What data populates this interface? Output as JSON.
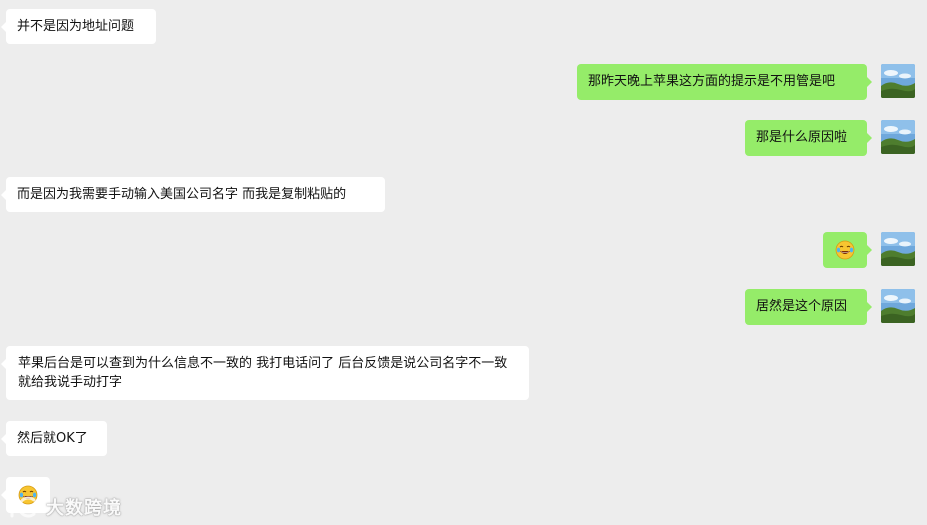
{
  "messages": [
    {
      "side": "left",
      "text": "并不是因为地址问题"
    },
    {
      "side": "right",
      "text": "那昨天晚上苹果这方面的提示是不用管是吧"
    },
    {
      "side": "right",
      "text": "那是什么原因啦"
    },
    {
      "side": "left",
      "text": "而是因为我需要手动输入美国公司名字 而我是复制粘贴的"
    },
    {
      "side": "right",
      "emoji": "laugh-cry-emoji"
    },
    {
      "side": "right",
      "text": "居然是这个原因"
    },
    {
      "side": "left",
      "text": "苹果后台是可以查到为什么信息不一致的 我打电话问了 后台反馈是说公司名字不一致 就给我说手动打字"
    },
    {
      "side": "left",
      "text": "然后就OK了"
    },
    {
      "side": "left",
      "emoji": "laugh-cry-emoji"
    }
  ],
  "watermark": {
    "text": "大数跨境"
  },
  "colors": {
    "background": "#ededed",
    "incoming_bubble": "#ffffff",
    "outgoing_bubble": "#95ec69"
  }
}
